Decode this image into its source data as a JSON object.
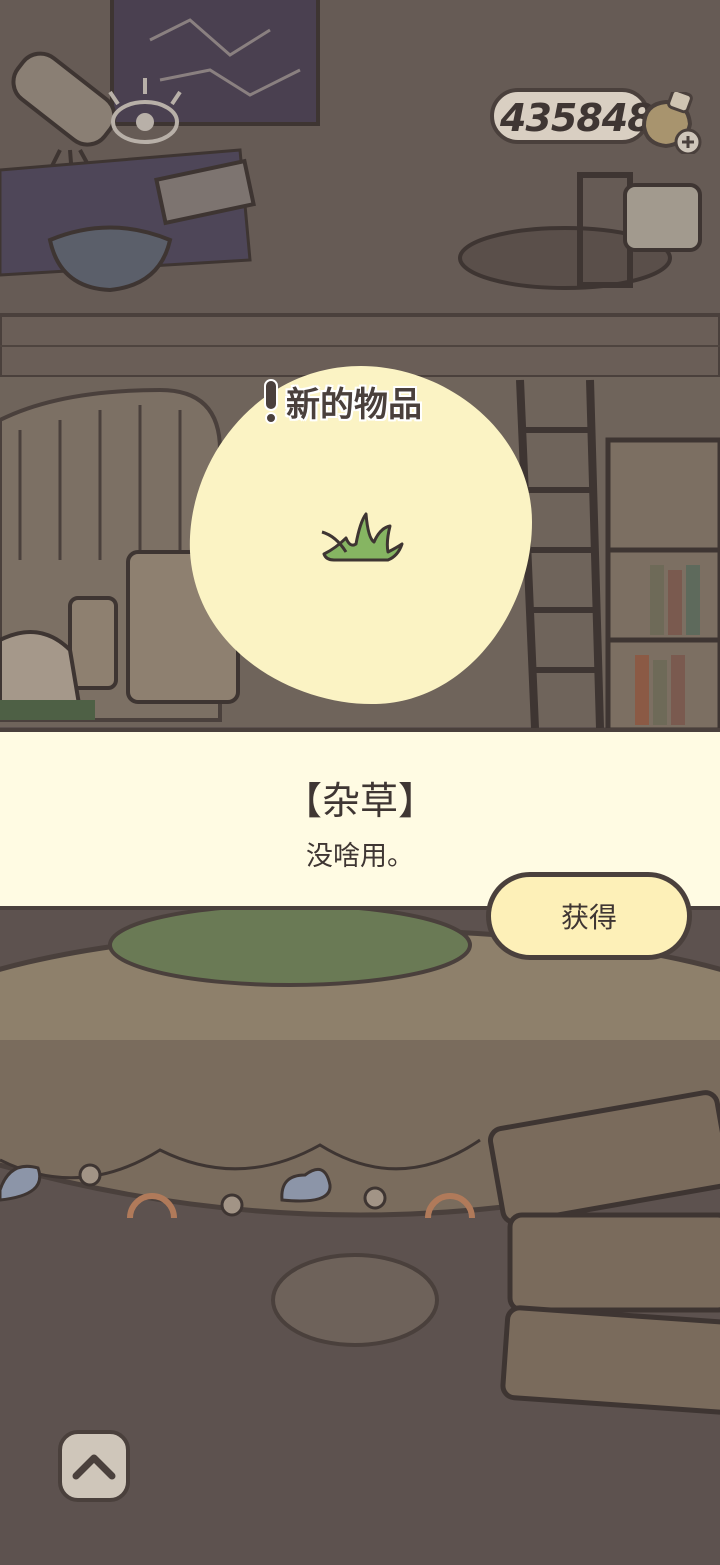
{
  "hud": {
    "coin_count": "435848",
    "coin_icon": "clover-pot-plus-icon"
  },
  "popup": {
    "title": "新的物品",
    "title_icon": "exclamation-icon",
    "item_icon": "weed-grass-icon",
    "item_name": "【杂草】",
    "item_description": "没啥用。",
    "obtain_button_label": "获得"
  },
  "controls": {
    "scroll_up_icon": "chevron-up-icon"
  },
  "colors": {
    "background_dim": "#5d524f",
    "outline": "#4a403c",
    "panel": "#fffbe3",
    "button": "#fdf0b8",
    "blob": "#fbf3c4",
    "grass": "#86b562"
  }
}
